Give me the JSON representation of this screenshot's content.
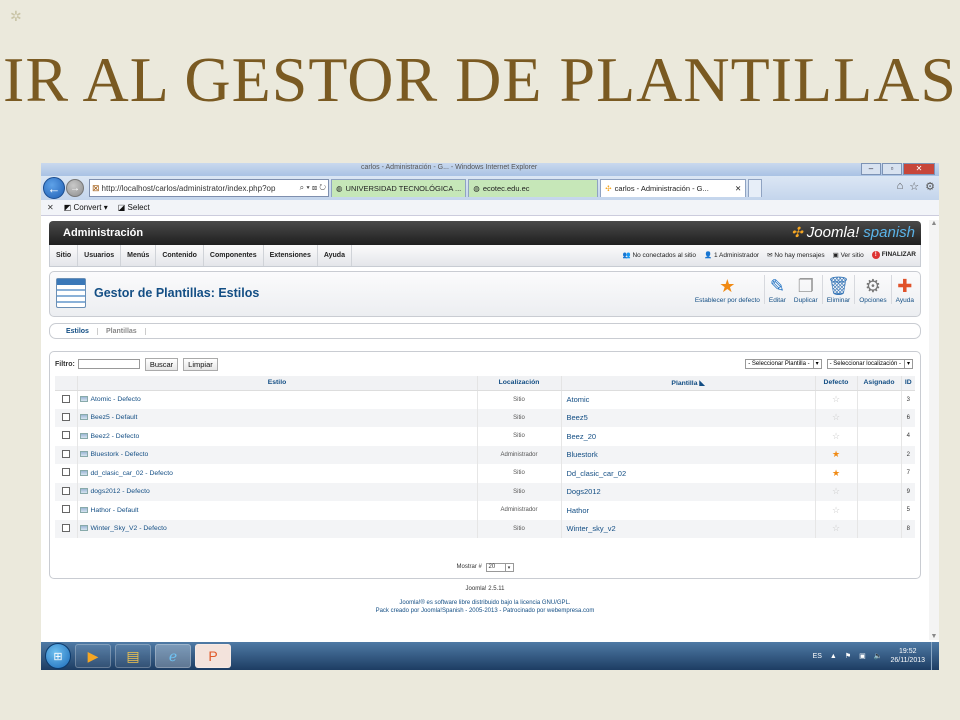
{
  "slide": {
    "title": "IR AL GESTOR DE PLANTILLAS"
  },
  "browser": {
    "window_title": "carlos - Administración - G... - Windows Internet Explorer",
    "address": "http://localhost/carlos/administrator/index.php?op",
    "address_host": "localhost",
    "tabs": [
      {
        "label": "UNIVERSIDAD TECNOLÓGICA ..."
      },
      {
        "label": "ecotec.edu.ec"
      },
      {
        "label": "carlos - Administración - G..."
      }
    ],
    "cmdbar": {
      "convert": "Convert",
      "select": "Select"
    }
  },
  "joomla": {
    "header": "Administración",
    "logo_main": "Joomla!",
    "logo_sub": "spanish",
    "menu": [
      "Sitio",
      "Usuarios",
      "Menús",
      "Contenido",
      "Componentes",
      "Extensiones",
      "Ayuda"
    ],
    "status": {
      "offline": "No conectados al sitio",
      "admins": "1 Administrador",
      "messages": "No hay mensajes",
      "view_site": "Ver sitio",
      "logout": "FINALIZAR"
    },
    "page_title": "Gestor de Plantillas: Estilos",
    "toolbar": {
      "default": "Establecer por defecto",
      "edit": "Editar",
      "duplicate": "Duplicar",
      "delete": "Eliminar",
      "options": "Opciones",
      "help": "Ayuda"
    },
    "subtabs": [
      "Estilos",
      "Plantillas"
    ],
    "filter": {
      "label": "Filtro:",
      "search_btn": "Buscar",
      "clear_btn": "Limpiar",
      "template_select": "- Seleccionar Plantilla -",
      "location_select": "- Seleccionar localización -"
    },
    "columns": {
      "style": "Estilo",
      "location": "Localización",
      "template": "Plantilla",
      "default": "Defecto",
      "assigned": "Asignado",
      "id": "ID"
    },
    "rows": [
      {
        "style": "Atomic - Defecto",
        "location": "Sitio",
        "template": "Atomic",
        "default": false,
        "id": "3"
      },
      {
        "style": "Beez5 - Default",
        "location": "Sitio",
        "template": "Beez5",
        "default": false,
        "id": "6"
      },
      {
        "style": "Beez2 - Defecto",
        "location": "Sitio",
        "template": "Beez_20",
        "default": false,
        "id": "4"
      },
      {
        "style": "Bluestork - Defecto",
        "location": "Administrador",
        "template": "Bluestork",
        "default": true,
        "id": "2"
      },
      {
        "style": "dd_clasic_car_02 - Defecto",
        "location": "Sitio",
        "template": "Dd_clasic_car_02",
        "default": true,
        "id": "7"
      },
      {
        "style": "dogs2012 - Defecto",
        "location": "Sitio",
        "template": "Dogs2012",
        "default": false,
        "id": "9"
      },
      {
        "style": "Hathor - Default",
        "location": "Administrador",
        "template": "Hathor",
        "default": false,
        "id": "5"
      },
      {
        "style": "Winter_Sky_V2 - Defecto",
        "location": "Sitio",
        "template": "Winter_sky_v2",
        "default": false,
        "id": "8"
      }
    ],
    "pager": {
      "label": "Mostrar #",
      "value": "20"
    },
    "footer": {
      "version": "Joomla! 2.5.11",
      "license": "Joomla!® es software libre distribuido bajo la licencia GNU/GPL.",
      "credits": "Pack creado por Joomla!Spanish - 2005-2013 - Patrocinado por webempresa.com"
    }
  },
  "taskbar": {
    "lang": "ES",
    "time": "19:52",
    "date": "26/11/2013"
  },
  "colors": {
    "title": "#7a5a22",
    "link": "#134e84",
    "star_on": "#f08a14"
  }
}
